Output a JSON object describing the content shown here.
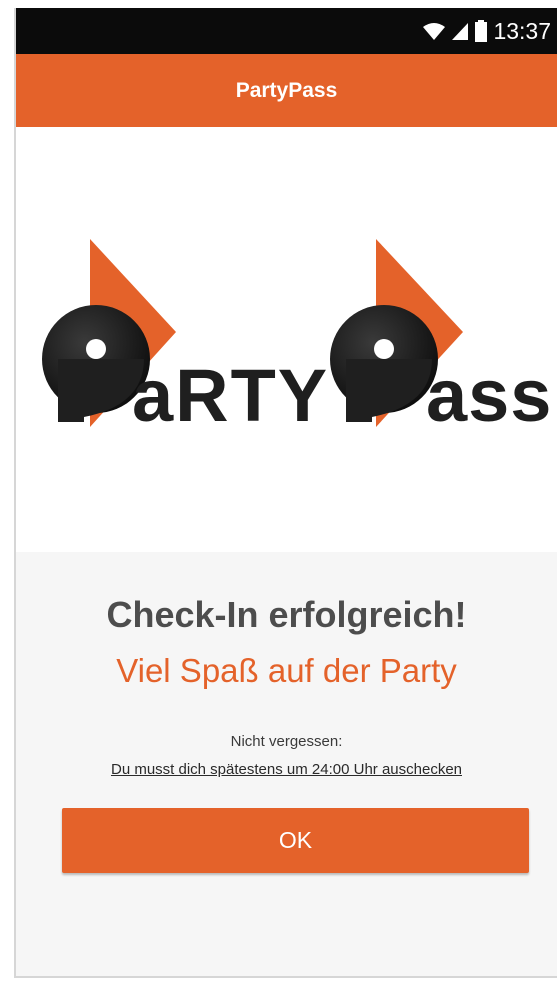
{
  "status_bar": {
    "time": "13:37",
    "icons": [
      "wifi-icon",
      "signal-icon",
      "battery-icon"
    ]
  },
  "app_bar": {
    "title": "PartyPass"
  },
  "logo": {
    "text": "PaRTY Pass"
  },
  "message": {
    "headline": "Check-In erfolgreich!",
    "subheadline": "Viel Spaß auf der Party",
    "reminder_label": "Nicht vergessen:",
    "reminder_text": "Du musst dich spätestens um 24:00 Uhr auschecken"
  },
  "actions": {
    "ok_label": "OK"
  },
  "colors": {
    "accent": "#e4622a",
    "status_bar": "#0b0b0b",
    "headline": "#4d4d4d",
    "logo_dark": "#1f1f1f"
  }
}
